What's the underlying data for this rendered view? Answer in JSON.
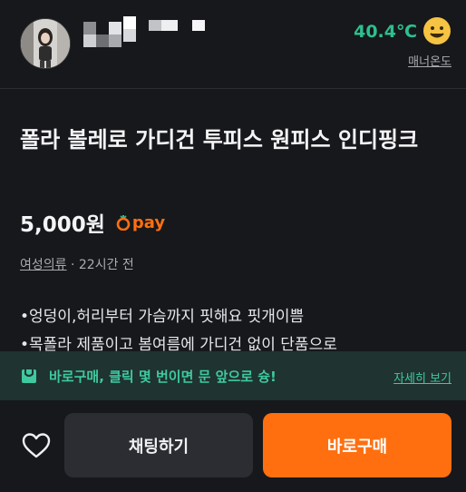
{
  "seller": {
    "temperature": "40.4℃",
    "manner_label": "매너온도"
  },
  "item": {
    "title": "폴라 볼레로 가디건 투피스 원피스 인디핑크",
    "price": "5,000원",
    "pay_label": "pay",
    "category": "여성의류",
    "time": "22시간 전",
    "description": [
      "•엉덩이,허리부터 가슴까지 핏해요 핏개이쁨",
      "•목폴라 제품이고 봄여름에 가디건 없이 단품으로"
    ]
  },
  "banner": {
    "text": "바로구매, 클릭 몇 번이면 문 앞으로 슝!",
    "link": "자세히 보기"
  },
  "actions": {
    "chat_label": "채팅하기",
    "buy_label": "바로구매"
  },
  "colors": {
    "background": "#17181b",
    "accent_orange": "#ff6f0f",
    "accent_green": "#2dbf8f",
    "banner_bg": "#1f3330"
  }
}
